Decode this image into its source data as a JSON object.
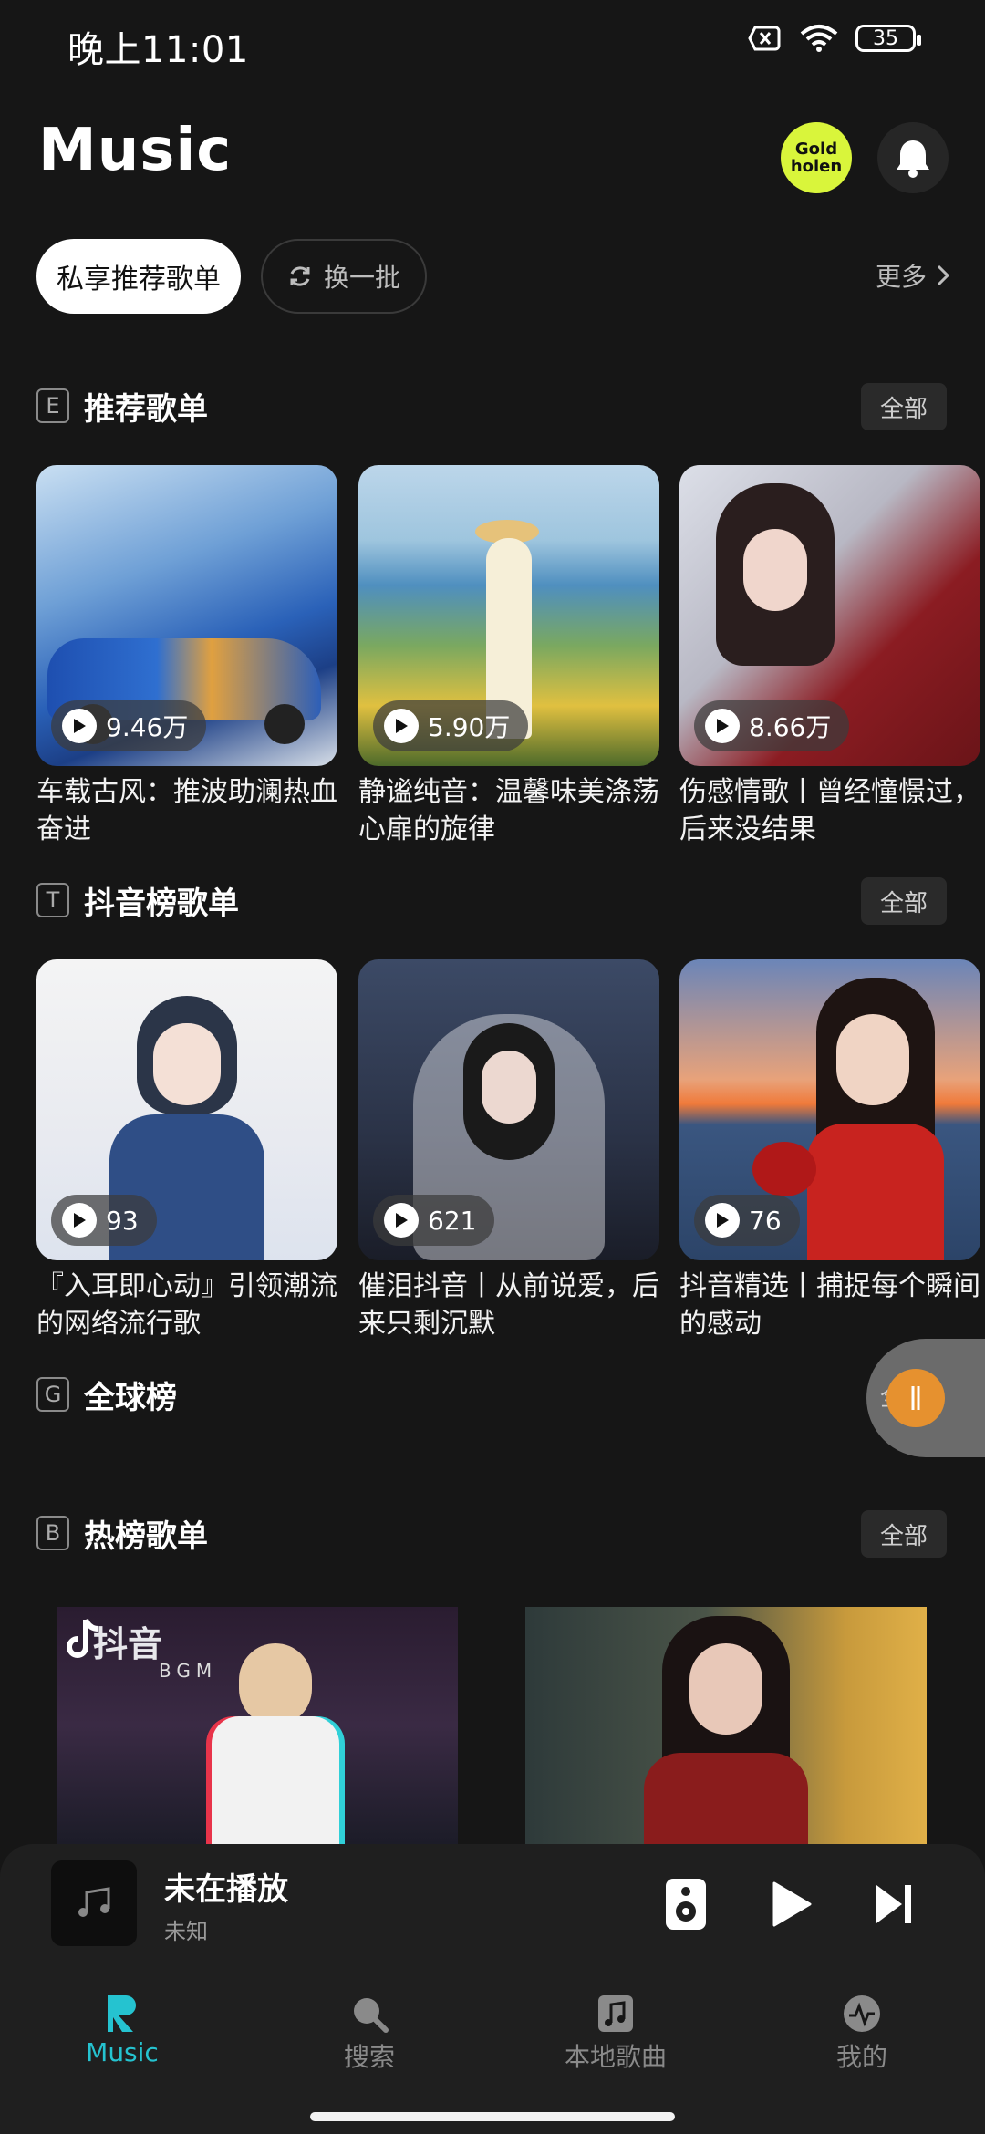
{
  "status_bar": {
    "time": "晚上11:01",
    "battery": "35"
  },
  "header": {
    "title": "Music",
    "gold_logo_line1": "Gold",
    "gold_logo_line2": "holen"
  },
  "chips": {
    "active": "私享推荐歌单",
    "refresh": "换一批",
    "more": "更多"
  },
  "sections": [
    {
      "letter": "E",
      "title": "推荐歌单",
      "all": "全部",
      "cards": [
        {
          "count": "9.46万",
          "title": "车载古风：推波助澜热血奋进"
        },
        {
          "count": "5.90万",
          "title": "静谧纯音：温馨味美涤荡心扉的旋律"
        },
        {
          "count": "8.66万",
          "title": "伤感情歌丨曾经憧憬过，后来没结果"
        }
      ]
    },
    {
      "letter": "T",
      "title": "抖音榜歌单",
      "all": "全部",
      "cards": [
        {
          "count": "93",
          "title": "『入耳即心动』引领潮流的网络流行歌"
        },
        {
          "count": "621",
          "title": "催泪抖音丨从前说爱，后来只剩沉默"
        },
        {
          "count": "76",
          "title": "抖音精选丨捕捉每个瞬间的感动"
        }
      ]
    },
    {
      "letter": "G",
      "title": "全球榜",
      "all": "全部"
    },
    {
      "letter": "B",
      "title": "热榜歌单",
      "all": "全部",
      "hot_logo_text": "抖音",
      "hot_logo_sub": "BGM"
    }
  ],
  "now_playing": {
    "title": "未在播放",
    "artist": "未知"
  },
  "nav": [
    {
      "label": "Music",
      "icon": "r-logo-icon",
      "active": true
    },
    {
      "label": "搜索",
      "icon": "search-icon"
    },
    {
      "label": "本地歌曲",
      "icon": "local-music-icon"
    },
    {
      "label": "我的",
      "icon": "profile-pulse-icon"
    }
  ],
  "colors": {
    "accent": "#25c3d0",
    "gold": "#d9f53b",
    "background": "#161616"
  }
}
